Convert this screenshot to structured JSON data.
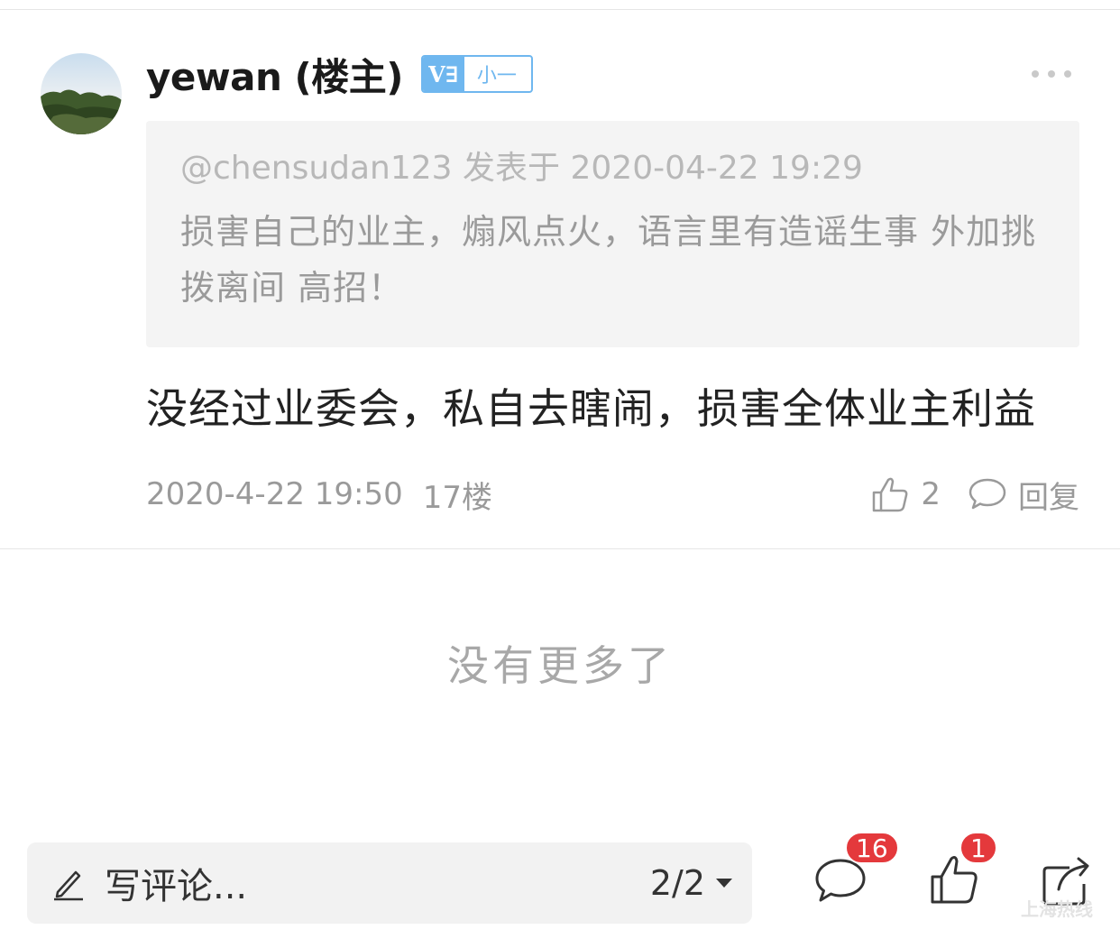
{
  "post": {
    "author": "yewan (楼主)",
    "badge": {
      "prefix": "V∃",
      "level": "小一",
      "color": "#6fb7ef"
    },
    "quote": {
      "meta": "@chensudan123 发表于 2020-04-22 19:29",
      "text": "损害自己的业主，煽风点火，语言里有造谣生事 外加挑拨离间  高招！"
    },
    "body": "没经过业委会，私自去瞎闹，损害全体业主利益",
    "time": "2020-4-22 19:50",
    "floor": "17楼",
    "like_count": "2",
    "reply_label": "回复"
  },
  "list_end": "没有更多了",
  "bottom_bar": {
    "comment_placeholder": "写评论...",
    "page_indicator": "2/2",
    "comments_badge": "16",
    "likes_badge": "1",
    "badge_color": "#e4393c"
  },
  "watermark": "上海热线"
}
